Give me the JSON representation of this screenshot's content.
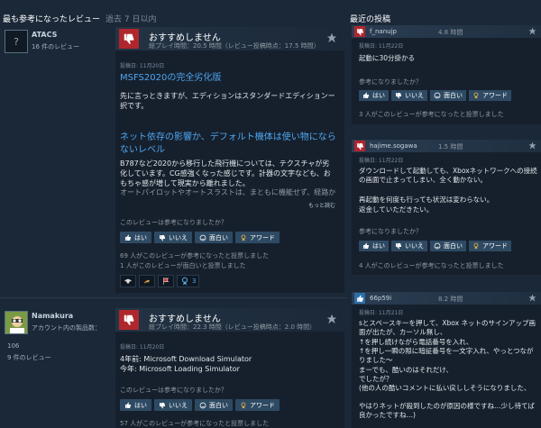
{
  "left": {
    "title": "最も参考になったレビュー",
    "subtitle": "過去 7 日以内",
    "reviews": [
      {
        "user": "ATACS",
        "reviews_count": "16 件のレビュー",
        "vote": "おすすめしません",
        "hours": "総プレイ時間：20.5 時間（レビュー投稿時点：17.5 時間）",
        "posted": "投稿日: 11月20日",
        "heading1": "MSFS2020の完全劣化版",
        "para1": "先に言っときますが、エディションはスタンダードエディションー択です。",
        "heading2": "ネット依存の影響か、デフォルト機体は使い物にならないレベル",
        "para2": "B787など2020から移行した飛行機については、テクスチャが劣化しています。CG感強くなった感じです。計器の文字なども、おもちゃ感が増して現実から離れました。",
        "para3": "オートパイロットやオートスラストは、まともに機能せず、経路か",
        "more": "もっと読む",
        "helpful_q": "このレビューは参考になりましたか？",
        "btn_yes": "はい",
        "btn_no": "いいえ",
        "btn_funny": "面白い",
        "btn_award": "アワード",
        "stat1": "69 人がこのレビューが参考になったと投票しました",
        "stat2": "1 人がこのレビューが面白いと投票しました",
        "award_count": "3"
      },
      {
        "user": "Namakura",
        "account_line": "アカウント内の製品数：",
        "products": "106",
        "reviews_count": "9 件のレビュー",
        "vote": "おすすめしません",
        "hours": "総プレイ時間：22.3 時間（レビュー投稿時点：2.0 時間）",
        "posted": "投稿日: 11月20日",
        "line1": "4年前: Microsoft Download Simulator",
        "line2": "今年: Microsoft Loading Simulator",
        "helpful_q": "このレビューは参考になりましたか？",
        "btn_yes": "はい",
        "btn_no": "いいえ",
        "btn_funny": "面白い",
        "btn_award": "アワード",
        "stat1": "57 人がこのレビューが参考になったと投票しました"
      }
    ]
  },
  "right": {
    "title": "最近の投稿",
    "posts": [
      {
        "name": "f_nanujp",
        "hours": "4.8 時間",
        "posted": "投稿日: 11月22日",
        "text": "起動に30分掛かる",
        "helpful_q": "参考になりましたか？",
        "btn_yes": "はい",
        "btn_no": "いいえ",
        "btn_funny": "面白い",
        "btn_award": "アワード",
        "stat": "3 人がこのレビューが参考になったと投票しました"
      },
      {
        "name": "hajime.sogawa",
        "hours": "1.5 時間",
        "posted": "投稿日: 11月22日",
        "text1": "ダウンロードして起動しても、Xboxネットワークへの接続の画面で止まってしまい、全く動かない。",
        "text2": "再起動を何度も行っても状況は変わらない。",
        "text3": "返金していただきたい。",
        "helpful_q": "参考になりましたか？",
        "btn_yes": "はい",
        "btn_no": "いいえ",
        "btn_funny": "面白い",
        "btn_award": "アワード",
        "stat": "4 人がこのレビューが参考になったと投票しました"
      },
      {
        "name": "66p59i",
        "hours": "8.2 時間",
        "posted": "投稿日: 11月21日",
        "text1": "sとスペースキーを押して、Xbox ネットのサインアップ画面が出たが、カーソル無し、",
        "text2": "↑を押し続けながら電話番号を入れ、",
        "text3": "↑を押し一瞬の隙に暗証番号を一文字入れ、やっとつながりました～",
        "text4": "まーでも、酷いのはそれだけ、",
        "text5": "でしたが？",
        "text6": "(他の人の酷いコメントに払い戻ししそうになりました、",
        "text7": "やはりネットが殺到したのが原因の様ですね…少し待てば良かったですね…)"
      }
    ]
  },
  "colors": {
    "background": "#1b2838",
    "not_recommended": "#b0262d",
    "recommended": "#2b6fa8",
    "link": "#4ea6ef"
  }
}
